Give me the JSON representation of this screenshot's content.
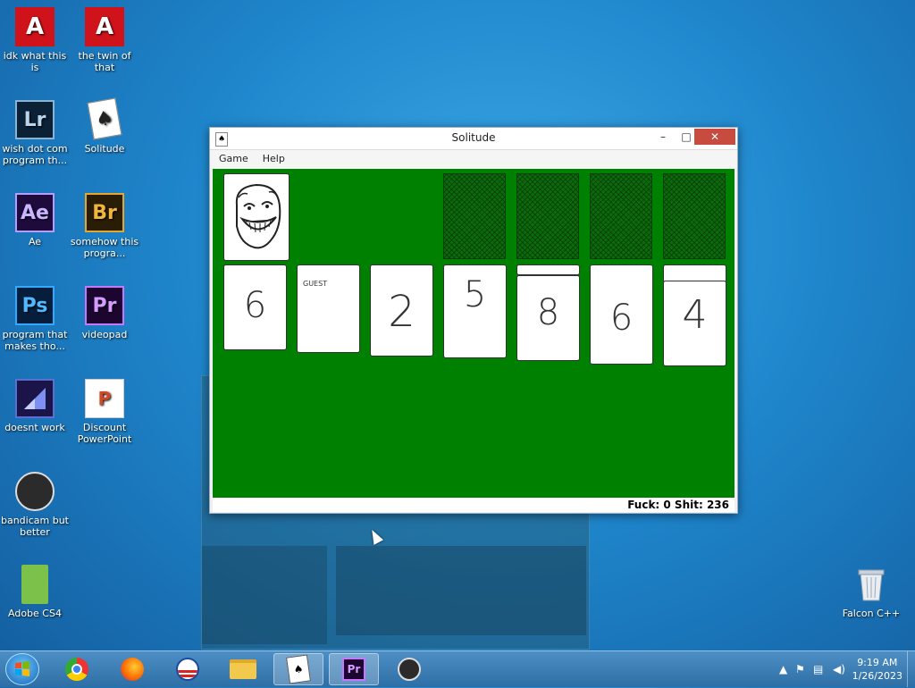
{
  "desktop": {
    "icons": [
      {
        "label": "idk what this is",
        "glyph": "A",
        "icon": "adobe-acrobat-icon"
      },
      {
        "label": "the twin of that",
        "glyph": "A",
        "icon": "adobe-acrobat-icon"
      },
      {
        "label": "wish dot com program th...",
        "glyph": "Lr",
        "icon": "lightroom-icon"
      },
      {
        "label": "Solitude",
        "glyph": "♠",
        "icon": "solitaire-cards-icon"
      },
      {
        "label": "Ae",
        "glyph": "Ae",
        "icon": "after-effects-icon"
      },
      {
        "label": "somehow this progra...",
        "glyph": "Br",
        "icon": "bridge-icon"
      },
      {
        "label": "program that makes tho...",
        "glyph": "Ps",
        "icon": "photoshop-icon"
      },
      {
        "label": "videopad",
        "glyph": "Pr",
        "icon": "premiere-icon"
      },
      {
        "label": "doesnt work",
        "glyph": "",
        "icon": "dreamweaver-icon"
      },
      {
        "label": "Discount PowerPoint",
        "glyph": "P",
        "icon": "powerpoint-icon"
      },
      {
        "label": "bandicam but better",
        "glyph": "",
        "icon": "obs-icon"
      },
      {
        "label": "Adobe CS4",
        "glyph": "",
        "icon": "folder-icon"
      },
      {
        "label": "Falcon C++",
        "glyph": "",
        "icon": "recycle-bin-icon"
      }
    ]
  },
  "window": {
    "title": "Solitude",
    "menu": [
      "Game",
      "Help"
    ],
    "controls": {
      "minimize": "–",
      "maximize": "□",
      "close": "✕"
    },
    "stock_card": {
      "face": "troll-face"
    },
    "tableau": [
      {
        "label": "6"
      },
      {
        "label": "GUEST"
      },
      {
        "label": "2"
      },
      {
        "label": "5"
      },
      {
        "label": "8"
      },
      {
        "label": "6"
      },
      {
        "label": "4"
      }
    ],
    "status": "Fuck: 0 Shit: 236"
  },
  "taskbar": {
    "clock_time": "9:19 AM",
    "clock_date": "1/26/2023",
    "apps": [
      "chrome-icon",
      "firefox-icon",
      "obama-icon",
      "file-explorer-icon",
      "solitaire-icon",
      "premiere-icon",
      "obs-icon"
    ],
    "active_apps": [
      "solitaire-icon",
      "premiere-icon"
    ]
  },
  "colors": {
    "felt": "#008000",
    "desktop": "#1f86cc",
    "close_button": "#c84b3f"
  }
}
